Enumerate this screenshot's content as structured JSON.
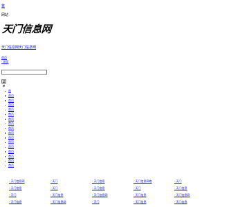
{
  "header": {
    "top_link": "首",
    "top_text": "网站",
    "logo_text": "天门信息网"
  },
  "subnav": {
    "label": "天门信息网天门信息网"
  },
  "small_links": [
    "首页",
    "· 首页"
  ],
  "search": {
    "placeholder": ""
  },
  "menu_toggle": {
    "label": "菜单"
  },
  "menu": {
    "items": [
      "首",
      "首页",
      "首页",
      "首页",
      "首页",
      "首页",
      "首页",
      "首页",
      "首页",
      "首页",
      "首页",
      "首页",
      "首页",
      "首页",
      "首页",
      "首页",
      "首页"
    ]
  },
  "links": [
    [
      "· 天门信息网",
      "· 天门",
      "· 天门信息",
      "· 天门信息网络",
      "· 天门"
    ],
    [
      "· 天门信息",
      "· 天门",
      "· 天门信息",
      "· 天门",
      "· 天门信息"
    ],
    [
      "· 天门",
      "· 天门信息",
      "· 天门信息网",
      "· 天门信息",
      "· 天门信息网"
    ],
    [
      "· 天门信息",
      "· 天门信息网",
      "· 天门",
      "· 天门信息",
      "· 天门信息"
    ]
  ],
  "colors": {
    "link": "#0000ee",
    "text": "#000000",
    "background": "#ffffff"
  }
}
